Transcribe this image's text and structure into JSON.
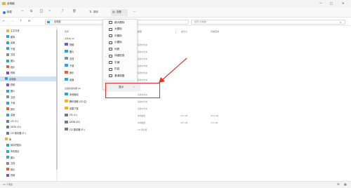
{
  "window": {
    "title": "此电脑",
    "controls": [
      "—",
      "□",
      "✕"
    ]
  },
  "toolbar": {
    "new_label": "新建",
    "sort_label": "排序",
    "view_label": "查看",
    "more_label": "···"
  },
  "address": {
    "path": "此电脑",
    "search_placeholder": "搜索\"此电脑\""
  },
  "columns": {
    "name": "名称",
    "type": "类型",
    "total": "总大小",
    "free": "可用空间"
  },
  "sidebar": {
    "items": [
      {
        "label": "主文件夹",
        "icon": "home-icon",
        "color": "#f0b429"
      },
      {
        "label": "图库",
        "icon": "gallery-icon",
        "color": "#2f9fe0"
      },
      {
        "label": "桌面",
        "icon": "desktop-icon",
        "color": "#2f9fe0"
      },
      {
        "label": "下载",
        "icon": "download-icon",
        "color": "#2f9fe0"
      },
      {
        "label": "文档",
        "icon": "documents-icon",
        "color": "#7d8fa3"
      },
      {
        "label": "图片",
        "icon": "pictures-icon",
        "color": "#2f9fe0"
      },
      {
        "label": "音乐",
        "icon": "music-icon",
        "color": "#e0603b"
      },
      {
        "label": "视频",
        "icon": "videos-icon",
        "color": "#7a4fd1"
      },
      {
        "label": "此电脑",
        "icon": "this-pc-icon",
        "color": "#2f9fe0"
      },
      {
        "label": "视频",
        "icon": "videos-icon",
        "color": "#7a4fd1"
      },
      {
        "label": "图片",
        "icon": "pictures-icon",
        "color": "#2f9fe0"
      },
      {
        "label": "文档",
        "icon": "documents-icon",
        "color": "#7d8fa3"
      },
      {
        "label": "下载",
        "icon": "download-icon",
        "color": "#2f9fe0"
      },
      {
        "label": "音乐",
        "icon": "music-icon",
        "color": "#e0603b"
      },
      {
        "label": "桌面",
        "icon": "desktop-icon",
        "color": "#2f9fe0"
      },
      {
        "label": "OS (C:)",
        "icon": "drive-icon",
        "color": "#6b7a8a"
      },
      {
        "label": "DATA (D:)",
        "icon": "drive-icon",
        "color": "#6b7a8a"
      },
      {
        "label": "CD 驱动器 (E:)",
        "icon": "cd-drive-icon",
        "color": "#6b7a8a"
      },
      {
        "label": "库",
        "icon": "library-icon",
        "color": "#f0b429"
      },
      {
        "label": "保存的图片",
        "icon": "pictures-icon",
        "color": "#2f9fe0"
      },
      {
        "label": "本机照片",
        "icon": "pictures-icon",
        "color": "#2f9fe0"
      },
      {
        "label": "图片",
        "icon": "pictures-icon",
        "color": "#2f9fe0"
      },
      {
        "label": "文档",
        "icon": "documents-icon",
        "color": "#7d8fa3"
      },
      {
        "label": "音乐",
        "icon": "music-icon",
        "color": "#e0603b"
      },
      {
        "label": "视频",
        "icon": "videos-icon",
        "color": "#7a4fd1"
      }
    ]
  },
  "folders_group": "文件夹 (6)",
  "folders": [
    {
      "name": "视频",
      "type": "系统文件夹",
      "color": "#7a4fd1"
    },
    {
      "name": "图片",
      "type": "系统文件夹",
      "color": "#2f9fe0"
    },
    {
      "name": "文档",
      "type": "系统文件夹",
      "color": "#7d8fa3"
    },
    {
      "name": "下载",
      "type": "系统文件夹",
      "color": "#2f9fe0"
    },
    {
      "name": "音乐",
      "type": "系统文件夹",
      "color": "#e0603b"
    },
    {
      "name": "桌面",
      "type": "系统文件夹",
      "color": "#2f9fe0"
    }
  ],
  "devices_group": "设备和驱动器 (6)",
  "devices": [
    {
      "name": "本地驱动",
      "type": "系统文件夹",
      "total": "",
      "free": "",
      "color": "#2f9fe0"
    },
    {
      "name": "腾讯视频 (32 位)",
      "type": "系统文件夹",
      "total": "",
      "free": "",
      "color": "#f0b429"
    },
    {
      "name": "迅雷下载",
      "type": "系统文件夹",
      "total": "",
      "free": "",
      "color": "#f0b429"
    },
    {
      "name": "OS (C:)",
      "type": "本地磁盘",
      "total": "237 GB",
      "free": "65.0 GB",
      "color": "#6b7a8a"
    },
    {
      "name": "DATA (D:)",
      "type": "本地磁盘",
      "total": "447 GB",
      "free": "216 GB",
      "color": "#6b7a8a"
    },
    {
      "name": "CD 驱动器 (E:)",
      "type": "CD 驱动器",
      "total": "",
      "free": "",
      "color": "#6b7a8a"
    }
  ],
  "view_menu": {
    "items": [
      {
        "label": "超大图标",
        "icon": "extra-large-icons-icon",
        "checked": false
      },
      {
        "label": "大图标",
        "icon": "large-icons-icon",
        "checked": false
      },
      {
        "label": "中图标",
        "icon": "medium-icons-icon",
        "checked": false
      },
      {
        "label": "小图标",
        "icon": "small-icons-icon",
        "checked": false
      },
      {
        "label": "列表",
        "icon": "list-icon",
        "checked": false
      },
      {
        "label": "详细信息",
        "icon": "details-icon",
        "checked": true
      },
      {
        "label": "平铺",
        "icon": "tiles-icon",
        "checked": false
      },
      {
        "label": "内容",
        "icon": "content-icon",
        "checked": false
      },
      {
        "label": "紧凑视图",
        "icon": "compact-view-icon",
        "checked": false
      }
    ],
    "show_label": "显示",
    "show_arrow": "›"
  },
  "status": {
    "count": "12 个项目"
  }
}
